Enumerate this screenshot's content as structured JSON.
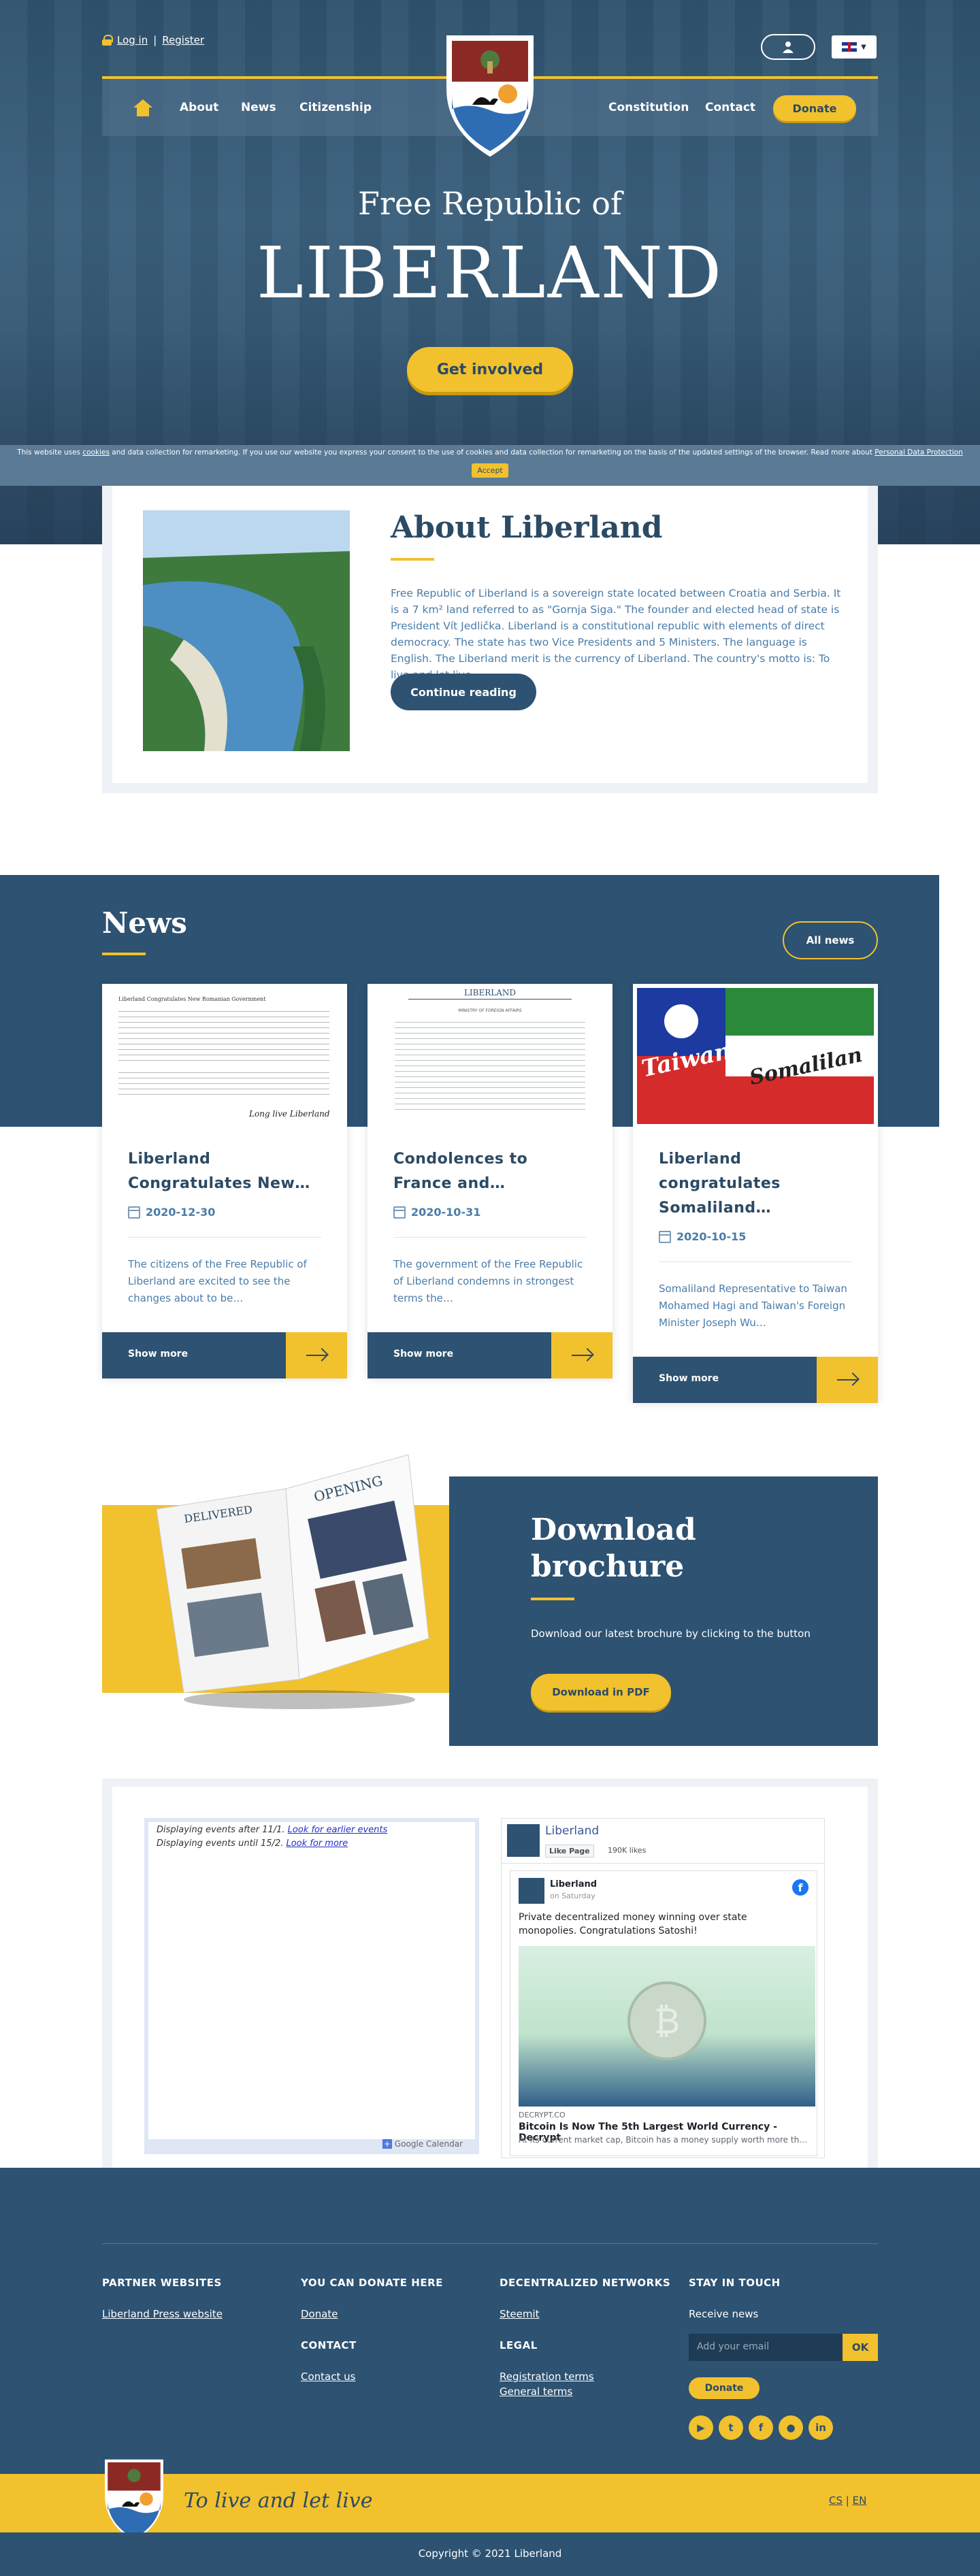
{
  "header": {
    "login": "Log in",
    "separator": "|",
    "register": "Register",
    "nav_left": [
      "About",
      "News",
      "Citizenship"
    ],
    "nav_right": [
      "Constitution",
      "Contact"
    ],
    "donate": "Donate"
  },
  "hero": {
    "subtitle": "Free Republic of",
    "title": "LIBERLAND",
    "cta": "Get involved"
  },
  "cookie": {
    "text_a": "This website uses ",
    "link_cookies": "cookies",
    "text_b": " and data collection for remarketing. If you use our website you express your consent to the use of cookies and data collection for remarketing on the basis of the updated settings of the browser. Read more about ",
    "link_pdp": "Personal Data Protection",
    "accept": "Accept"
  },
  "about": {
    "title": "About Liberland",
    "text": "Free Republic of Liberland is a sovereign state located between Croatia and Serbia. It is a 7 km² land referred to as \"Gornja Siga.\" The founder and elected head of state is President Vít Jedlička. Liberland is a constitutional republic with elements of direct democracy. The state has two Vice Presidents and 5 Ministers. The language is English. The Liberland merit is the currency of Liberland. The country's motto is: To live and let live.",
    "button": "Continue reading"
  },
  "news": {
    "title": "News",
    "all": "All news",
    "cards": [
      {
        "title": "Liberland Congratulates New…",
        "date": "2020-12-30",
        "excerpt": "The citizens of the Free Republic of Liberland are excited to see the changes about to be…",
        "more": "Show more"
      },
      {
        "title": "Condolences to France and…",
        "date": "2020-10-31",
        "excerpt": "The government of the Free Republic of Liberland condemns in strongest terms the…",
        "more": "Show more"
      },
      {
        "title": "Liberland congratulates Somaliland…",
        "date": "2020-10-15",
        "excerpt": "Somaliland Representative to Taiwan Mohamed Hagi and Taiwan's Foreign Minister Joseph Wu…",
        "more": "Show more"
      }
    ],
    "thumb1": {
      "heading": "Liberland Congratulates New Romanian Government",
      "signoff": "Long live Liberland"
    },
    "thumb2": {
      "heading": "LIBERLAND",
      "sub": "MINISTRY OF FOREIGN AFFAIRS"
    },
    "thumb3": {
      "word1": "Taiwan",
      "word2": "Somalilan"
    }
  },
  "brochure": {
    "title_line1": "Download",
    "title_line2": "brochure",
    "text": "Download our latest brochure by clicking to the button",
    "button": "Download in PDF",
    "book_word1": "DELIVERED",
    "book_word2": "OPENING"
  },
  "calendar": {
    "line1_text": "Displaying events after 11/1. ",
    "line1_link": "Look for earlier events",
    "line2_text": "Displaying events until 15/2. ",
    "line2_link": "Look for more",
    "badge": "Google Calendar"
  },
  "facebook": {
    "page": "Liberland",
    "like": "Like Page",
    "likes": "190K likes",
    "post_author": "Liberland",
    "post_date": "on Saturday",
    "post_text": "Private decentralized money winning over state monopolies. Congratulations Satoshi!",
    "source": "DECRYPT.CO",
    "headline": "Bitcoin Is Now The 5th Largest World Currency - Decrypt",
    "subline": "At its current market cap, Bitcoin has a money supply worth more th…"
  },
  "footer": {
    "partner_h": "PARTNER WEBSITES",
    "partner_link": "Liberland Press website",
    "donate_h": "YOU CAN DONATE HERE",
    "donate_link": "Donate",
    "contact_h": "CONTACT",
    "contact_link": "Contact us",
    "decent_h": "DECENTRALIZED NETWORKS",
    "decent_link": "Steemit",
    "legal_h": "LEGAL",
    "legal_1": "Registration terms",
    "legal_2": "General terms",
    "touch_h": "STAY IN TOUCH",
    "receive": "Receive news",
    "email_ph": "Add your email",
    "ok": "OK",
    "donate_btn": "Donate",
    "motto": "To live and let live",
    "lang_cs": "CS",
    "lang_sep": "|",
    "lang_en": "EN",
    "copyright": "Copyright © 2021 Liberland"
  },
  "icons": {
    "social": [
      "youtube-icon",
      "twitter-icon",
      "facebook-icon",
      "reddit-icon",
      "linkedin-icon"
    ]
  },
  "colors": {
    "brand_blue": "#2d5272",
    "accent_yellow": "#f2c12e"
  }
}
